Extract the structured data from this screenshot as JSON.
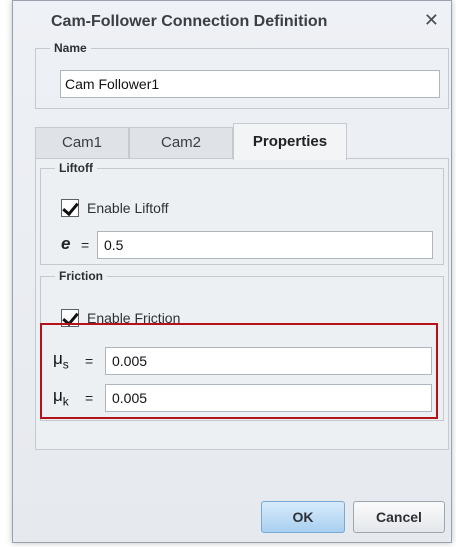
{
  "dialog": {
    "title": "Cam-Follower Connection Definition",
    "close_glyph": "✕"
  },
  "name_group": {
    "legend": "Name",
    "value": "Cam Follower1"
  },
  "tabs": [
    {
      "label": "Cam1",
      "active": false
    },
    {
      "label": "Cam2",
      "active": false
    },
    {
      "label": "Properties",
      "active": true
    }
  ],
  "liftoff": {
    "legend": "Liftoff",
    "checkbox_label": "Enable Liftoff",
    "checked": true,
    "symbol": "e",
    "equals": "=",
    "value": "0.5"
  },
  "friction": {
    "legend": "Friction",
    "checkbox_label": "Enable Friction",
    "checked": true,
    "static": {
      "symbol": "μ",
      "subscript": "s",
      "equals": "=",
      "value": "0.005"
    },
    "kinetic": {
      "symbol": "μ",
      "subscript": "k",
      "equals": "=",
      "value": "0.005"
    }
  },
  "buttons": {
    "ok": "OK",
    "cancel": "Cancel"
  },
  "colors": {
    "highlight": "#b31219",
    "ok_button": "#a9cff0"
  }
}
